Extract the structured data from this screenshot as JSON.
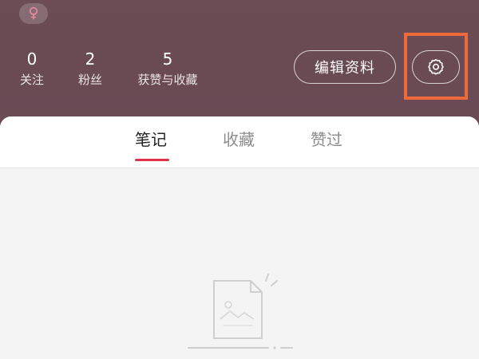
{
  "profile": {
    "gender_symbol": "♀",
    "stats": [
      {
        "num": "0",
        "label": "关注"
      },
      {
        "num": "2",
        "label": "粉丝"
      },
      {
        "num": "5",
        "label": "获赞与收藏"
      }
    ],
    "edit_label": "编辑资料"
  },
  "tabs": [
    {
      "label": "笔记",
      "active": true
    },
    {
      "label": "收藏",
      "active": false
    },
    {
      "label": "赞过",
      "active": false
    }
  ],
  "icons": {
    "gender": "female-icon",
    "settings": "gear-icon",
    "empty": "empty-note-icon"
  },
  "colors": {
    "header_bg": "#6b4b54",
    "accent": "#e0334a",
    "highlight": "#ee6a3a",
    "gender_icon": "#f08aa0"
  }
}
